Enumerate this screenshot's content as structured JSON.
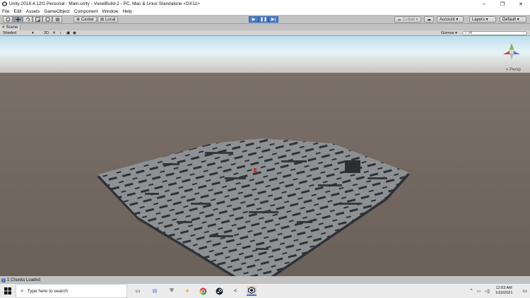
{
  "window": {
    "title": "Unity 2018.4.12f1 Personal - Main.unity - VoxelBuild-2 - PC, Mac & Linux Standalone <DX11>",
    "controls": [
      "–",
      "❐",
      "✕"
    ]
  },
  "menu": [
    "File",
    "Edit",
    "Assets",
    "GameObject",
    "Component",
    "Window",
    "Help"
  ],
  "toolbar": {
    "pivot_label": "Center",
    "space_label": "Local",
    "collab_label": "Collab ▾",
    "account_label": "Account ▾",
    "layers_label": "Layers ▾",
    "layout_label": "Default ▾"
  },
  "scene": {
    "tab_label": "Scene",
    "shading_mode": "Shaded",
    "mode_2d": "2D",
    "gizmos_label": "Gizmos ▾",
    "search_placeholder": "All",
    "persp_label": "< Persp"
  },
  "status": {
    "message": "1 Chunks Loaded"
  },
  "taskbar": {
    "search_placeholder": "Type here to search",
    "time": "12:03 AM",
    "date": "1/23/2021"
  },
  "colors": {
    "sky_top": "#d8ebf2",
    "ground": "#6e645c",
    "voxel_top": "#8e9194",
    "voxel_shadow": "#2e3136",
    "accent_play": "#4a7fd0"
  }
}
